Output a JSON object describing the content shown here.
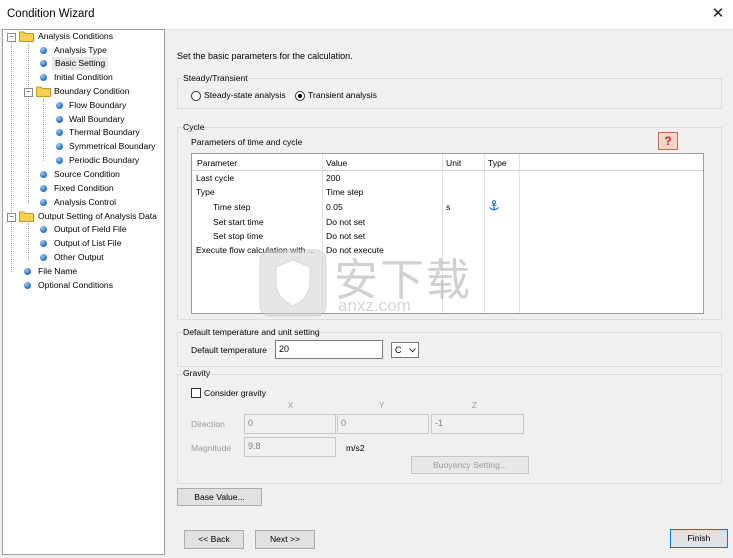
{
  "window": {
    "title": "Condition Wizard",
    "close_glyph": "✕"
  },
  "tree": {
    "items": [
      {
        "label": "Analysis Conditions",
        "kind": "folder"
      },
      {
        "label": "Analysis Type",
        "kind": "leaf"
      },
      {
        "label": "Basic Setting",
        "kind": "leaf",
        "selected": true
      },
      {
        "label": "Initial Condition",
        "kind": "leaf"
      },
      {
        "label": "Boundary Condition",
        "kind": "folder"
      },
      {
        "label": "Flow Boundary",
        "kind": "leaf"
      },
      {
        "label": "Wall Boundary",
        "kind": "leaf"
      },
      {
        "label": "Thermal Boundary",
        "kind": "leaf"
      },
      {
        "label": "Symmetrical Boundary",
        "kind": "leaf"
      },
      {
        "label": "Periodic Boundary",
        "kind": "leaf"
      },
      {
        "label": "Source Condition",
        "kind": "leaf"
      },
      {
        "label": "Fixed Condition",
        "kind": "leaf"
      },
      {
        "label": "Analysis Control",
        "kind": "leaf"
      },
      {
        "label": "Output Setting of Analysis Data",
        "kind": "folder"
      },
      {
        "label": "Output of Field File",
        "kind": "leaf"
      },
      {
        "label": "Output of List File",
        "kind": "leaf"
      },
      {
        "label": "Other Output",
        "kind": "leaf"
      },
      {
        "label": "File Name",
        "kind": "leaf"
      },
      {
        "label": "Optional Conditions",
        "kind": "leaf"
      }
    ]
  },
  "main": {
    "instruction": "Set the basic parameters for the calculation.",
    "steady": {
      "group_label": "Steady/Transient",
      "option_steady": "Steady-state analysis",
      "option_transient": "Transient analysis",
      "selected": "transient"
    },
    "cycle": {
      "group_label": "Cycle",
      "subtitle": "Parameters of time and cycle",
      "help_glyph": "?",
      "columns": [
        "Parameter",
        "Value",
        "Unit",
        "Type"
      ],
      "rows": [
        {
          "param": "Last cycle",
          "value": "200",
          "unit": "",
          "type": ""
        },
        {
          "param": "Type",
          "value": "Time step",
          "unit": "",
          "type": ""
        },
        {
          "param": "Time step",
          "value": "0.05",
          "unit": "s",
          "type": "anchor-icon"
        },
        {
          "param": "Set start time",
          "value": "Do not set",
          "unit": "",
          "type": ""
        },
        {
          "param": "Set stop time",
          "value": "Do not set",
          "unit": "",
          "type": ""
        },
        {
          "param": "Execute flow calculation with ...",
          "value": "Do not execute",
          "unit": "",
          "type": ""
        }
      ]
    },
    "temperature": {
      "group_label": "Default temperature and unit setting",
      "label": "Default temperature",
      "value": "20",
      "unit": "C"
    },
    "gravity": {
      "group_label": "Gravity",
      "checkbox_label": "Consider gravity",
      "checked": false,
      "axis_x": "X",
      "axis_y": "Y",
      "axis_z": "Z",
      "direction_label": "Direction",
      "dir_x": "0",
      "dir_y": "0",
      "dir_z": "-1",
      "magnitude_label": "Magnitude",
      "magnitude": "9.8",
      "magnitude_unit": "m/s2",
      "buoyancy_button": "Buoyancy Setting..."
    },
    "base_value_button": "Base Value..."
  },
  "footer": {
    "back": "<< Back",
    "next": "Next >>",
    "finish": "Finish"
  },
  "watermark": {
    "text": "安下载",
    "subtext": "anxz.com"
  }
}
